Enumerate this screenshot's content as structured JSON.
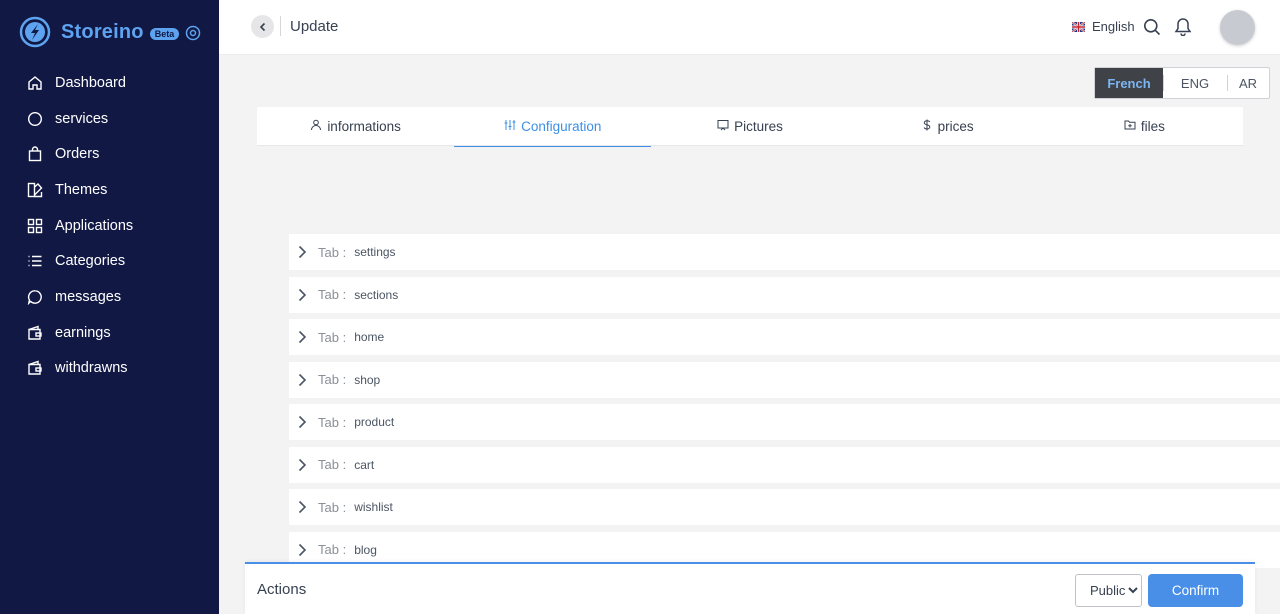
{
  "brand": {
    "name": "Storeino",
    "badge": "Beta",
    "accent_color": "#5da3f0",
    "sidebar_bg": "#111844"
  },
  "sidebar": {
    "items": [
      {
        "label": "Dashboard",
        "icon": "home-icon"
      },
      {
        "label": "services",
        "icon": "circle-icon"
      },
      {
        "label": "Orders",
        "icon": "shopping-bag-icon"
      },
      {
        "label": "Themes",
        "icon": "themes-icon"
      },
      {
        "label": "Applications",
        "icon": "grid-icon"
      },
      {
        "label": "Categories",
        "icon": "list-icon"
      },
      {
        "label": "messages",
        "icon": "message-circle-icon"
      },
      {
        "label": "earnings",
        "icon": "wallet-icon"
      },
      {
        "label": "withdrawns",
        "icon": "wallet-icon"
      }
    ]
  },
  "header": {
    "title": "Update",
    "language": "English"
  },
  "content_language": {
    "options": [
      "French",
      "ENG",
      "AR"
    ],
    "selected": "French"
  },
  "tabs": [
    {
      "label": "informations",
      "icon": "user-icon",
      "active": false
    },
    {
      "label": "Configuration",
      "icon": "sliders-icon",
      "active": true
    },
    {
      "label": "Pictures",
      "icon": "picture-icon",
      "active": false
    },
    {
      "label": "prices",
      "icon": "dollar-icon",
      "active": false
    },
    {
      "label": "files",
      "icon": "folder-plus-icon",
      "active": false
    }
  ],
  "config_tabs": {
    "prefix": "Tab :",
    "items": [
      "settings",
      "sections",
      "home",
      "shop",
      "product",
      "cart",
      "wishlist",
      "blog"
    ]
  },
  "actions": {
    "title": "Actions",
    "visibility": "Public",
    "visibility_options": [
      "Public"
    ],
    "confirm_label": "Confirm",
    "accent_color": "#4a8fe7"
  }
}
